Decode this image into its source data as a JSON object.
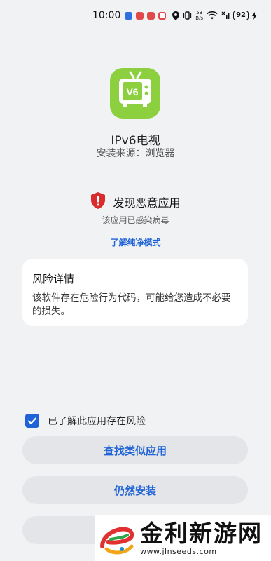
{
  "status_bar": {
    "time": "10:00",
    "net_speed_value": "53",
    "net_speed_unit": "B/s",
    "battery": "92",
    "notif_colors": [
      "#2f6fe0",
      "#e04a4a",
      "#e04a4a",
      "#e04a4a"
    ]
  },
  "app": {
    "name": "IPv6电视",
    "icon_text": "V6",
    "icon_color": "#8ccf3f",
    "source_label": "安装来源：",
    "source_value": "浏览器"
  },
  "warning": {
    "title": "发现恶意应用",
    "subtitle": "该应用已感染病毒",
    "link": "了解纯净模式",
    "shield_color": "#d92d2d"
  },
  "risk": {
    "title": "风险详情",
    "description": "该软件存在危险行为代码，可能给您造成不必要的损失。"
  },
  "acknowledge": {
    "label": "已了解此应用存在风险",
    "checked": true
  },
  "buttons": {
    "find_similar": "查找类似应用",
    "install_anyway": "仍然安装",
    "third": ""
  },
  "watermark": {
    "text": "金利新游网",
    "url": "www.jlnseeds.com"
  },
  "colors": {
    "accent": "#1f63d6",
    "background": "#f1f2f4",
    "card": "#ffffff",
    "button_bg": "#e4e5e8"
  }
}
